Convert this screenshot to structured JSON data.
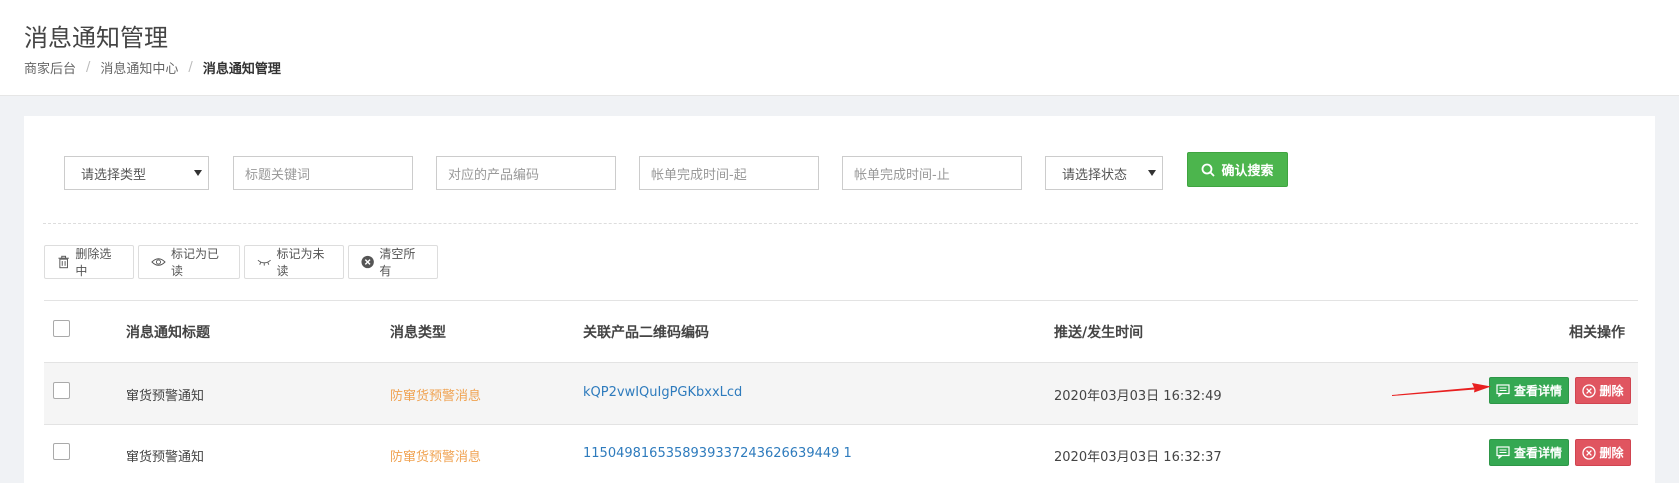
{
  "page": {
    "title": "消息通知管理",
    "breadcrumb": [
      "商家后台",
      "消息通知中心",
      "消息通知管理"
    ],
    "breadcrumb_sep": "/"
  },
  "search": {
    "type_select": "请选择类型",
    "title_keyword_placeholder": "标题关键词",
    "product_code_placeholder": "对应的产品编码",
    "bill_time_start_placeholder": "帐单完成时间-起",
    "bill_time_end_placeholder": "帐单完成时间-止",
    "status_select": "请选择状态",
    "confirm_label": "确认搜索"
  },
  "toolbar": {
    "delete_selected": "删除选中",
    "mark_read": "标记为已读",
    "mark_unread": "标记为未读",
    "clear_all": "清空所有"
  },
  "table": {
    "headers": [
      "消息通知标题",
      "消息类型",
      "关联产品二维码编码",
      "推送/发生时间",
      "相关操作"
    ],
    "rows": [
      {
        "title": "窜货预警通知",
        "type": "防窜货预警消息",
        "code": "kQP2vwIQuIgPGKbxxLcd",
        "time": "2020年03月03日 16:32:49",
        "view": "查看详情",
        "delete": "删除"
      },
      {
        "title": "窜货预警通知",
        "type": "防窜货预警消息",
        "code": "1150498165358939337243626639449 1",
        "time": "2020年03月03日 16:32:37",
        "view": "查看详情",
        "delete": "删除"
      }
    ]
  },
  "colors": {
    "accent_green": "#4cb54d",
    "view_green": "#35a852",
    "delete_red": "#e05560",
    "type_orange": "#f0a352",
    "code_blue": "#2e7bbd",
    "arrow_red": "#e82020"
  }
}
